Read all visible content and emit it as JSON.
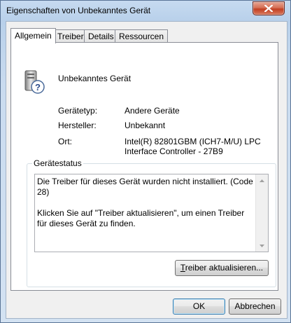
{
  "window": {
    "title": "Eigenschaften von Unbekanntes Gerät"
  },
  "tabs": [
    {
      "label": "Allgemein",
      "active": true
    },
    {
      "label": "Treiber",
      "active": false
    },
    {
      "label": "Details",
      "active": false
    },
    {
      "label": "Ressourcen",
      "active": false
    }
  ],
  "device": {
    "name": "Unbekanntes Gerät",
    "icon": "unknown-device-icon"
  },
  "properties": {
    "type_label": "Gerätetyp:",
    "type_value": "Andere Geräte",
    "manufacturer_label": "Hersteller:",
    "manufacturer_value": "Unbekannt",
    "location_label": "Ort:",
    "location_value": "Intel(R) 82801GBM (ICH7-M/U) LPC Interface Controller - 27B9"
  },
  "status": {
    "group_label": "Gerätestatus",
    "line1": "Die Treiber für dieses Gerät wurden nicht installiert. (Code 28)",
    "line2": "Klicken Sie auf \"Treiber aktualisieren\", um einen Treiber für dieses Gerät zu finden."
  },
  "buttons": {
    "update_driver_mnemonic": "T",
    "update_driver_rest": "reiber aktualisieren...",
    "ok": "OK",
    "cancel": "Abbrechen"
  },
  "colors": {
    "close_button": "#c8452a",
    "window_frame": "#b9d1ea",
    "default_button_border": "#3c7fb1"
  }
}
